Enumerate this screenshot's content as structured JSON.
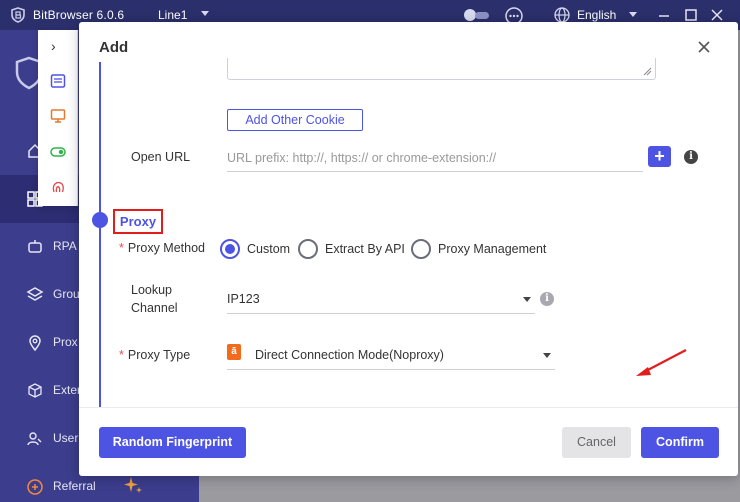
{
  "app": {
    "title": "BitBrowser 6.0.6",
    "line": "Line1",
    "language": "English"
  },
  "sidebar": {
    "items": [
      {
        "label": "",
        "icon": "home-icon"
      },
      {
        "label": "",
        "icon": "grid-icon"
      },
      {
        "label": "RPA",
        "icon": "rpa-icon"
      },
      {
        "label": "Grou",
        "icon": "group-icon"
      },
      {
        "label": "Prox",
        "icon": "location-icon"
      },
      {
        "label": "Exter",
        "icon": "cube-icon"
      },
      {
        "label": "User",
        "icon": "users-icon"
      },
      {
        "label": "Referral",
        "icon": "referral-icon"
      }
    ]
  },
  "modal": {
    "title": "Add",
    "add_cookie_label": "Add Other Cookie",
    "open_url": {
      "label": "Open URL",
      "placeholder": "URL prefix: http://, https:// or chrome-extension://"
    },
    "proxy": {
      "section_title": "Proxy",
      "method_label": "Proxy Method",
      "method_options": [
        "Custom",
        "Extract By API",
        "Proxy Management"
      ],
      "selected_method": "Custom",
      "lookup_label_line1": "Lookup",
      "lookup_label_line2": "Channel",
      "lookup_value": "IP123",
      "type_label": "Proxy Type",
      "type_value": "Direct Connection Mode(Noproxy)"
    },
    "buttons": {
      "random": "Random Fingerprint",
      "cancel": "Cancel",
      "confirm": "Confirm"
    }
  },
  "colors": {
    "accent": "#4d53e3",
    "sidebar": "#3c3d8c",
    "titlebar": "#2b2f6b",
    "highlight_box": "#e11d1d"
  }
}
